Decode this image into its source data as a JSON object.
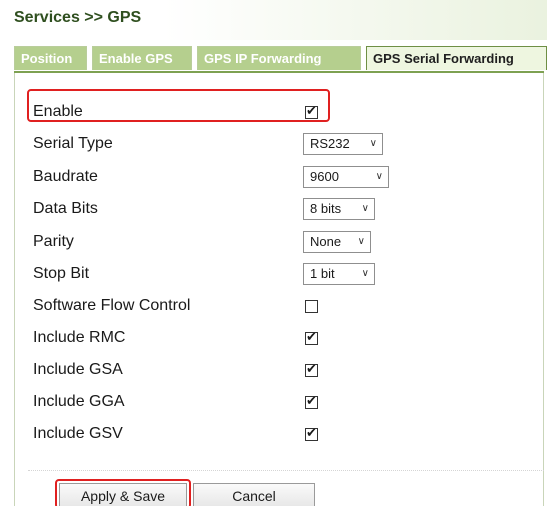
{
  "breadcrumb": "Services >> GPS",
  "tabs": [
    {
      "label": "Position",
      "active": false
    },
    {
      "label": "Enable GPS",
      "active": false
    },
    {
      "label": "GPS IP Forwarding",
      "active": false
    },
    {
      "label": "GPS Serial Forwarding",
      "active": true
    }
  ],
  "form": {
    "enable": {
      "label": "Enable",
      "checked": true
    },
    "serial_type": {
      "label": "Serial Type",
      "value": "RS232"
    },
    "baudrate": {
      "label": "Baudrate",
      "value": "9600"
    },
    "data_bits": {
      "label": "Data Bits",
      "value": "8 bits"
    },
    "parity": {
      "label": "Parity",
      "value": "None"
    },
    "stop_bit": {
      "label": "Stop Bit",
      "value": "1 bit"
    },
    "software_flow_control": {
      "label": "Software Flow Control",
      "checked": false
    },
    "include_rmc": {
      "label": "Include RMC",
      "checked": true
    },
    "include_gsa": {
      "label": "Include GSA",
      "checked": true
    },
    "include_gga": {
      "label": "Include GGA",
      "checked": true
    },
    "include_gsv": {
      "label": "Include GSV",
      "checked": true
    }
  },
  "buttons": {
    "apply_save": "Apply & Save",
    "cancel": "Cancel"
  },
  "glyphs": {
    "check": "✔",
    "chevron": "∨"
  },
  "colors": {
    "highlight": "#e02020",
    "tab_inactive": "#b5cf8e",
    "tab_active_bg": "#eef6e0"
  }
}
